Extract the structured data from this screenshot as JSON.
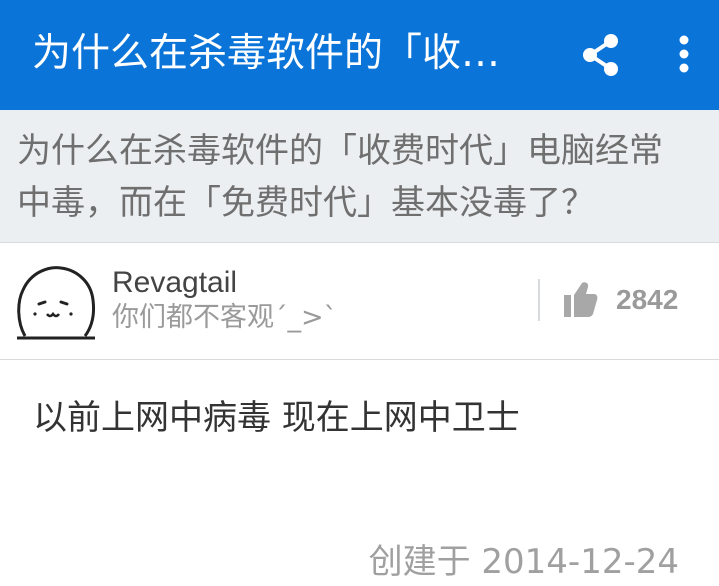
{
  "app_bar": {
    "title": "为什么在杀毒软件的「收…",
    "share_icon": "share-icon",
    "more_icon": "more-vertical-icon",
    "background_color": "#0b74d8"
  },
  "question": {
    "line1": "为什么在杀毒软件的「收费时代」电脑经常",
    "line2": "中毒，而在「免费时代」基本没毒了？"
  },
  "answer": {
    "author_name": "Revagtail",
    "author_bio": "你们都不客观´_>`",
    "avatar_icon": "cartoon-face-avatar",
    "upvote_icon": "thumbs-up-icon",
    "upvote_count": "2842",
    "body": "以前上网中病毒 现在上网中卫士",
    "created_at": "创建于 2014-12-24"
  }
}
